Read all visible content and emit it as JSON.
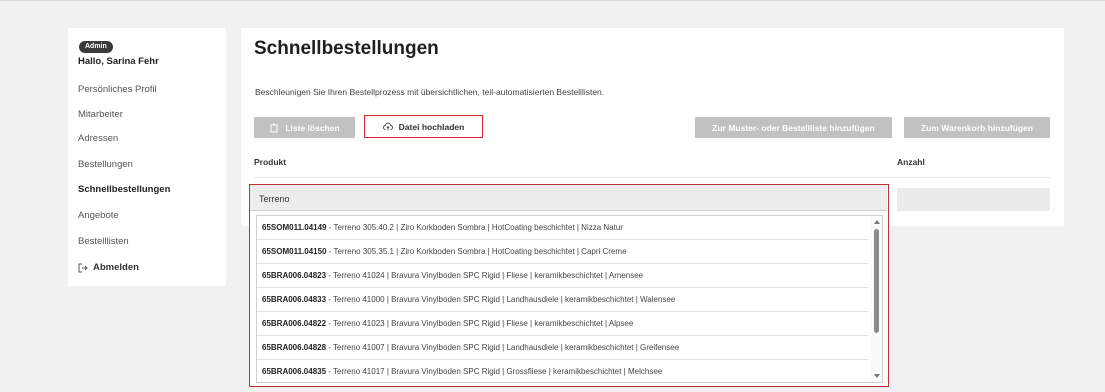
{
  "sidebar": {
    "role_badge": "Admin",
    "greeting": "Hallo, Sarina Fehr",
    "items": [
      {
        "label": "Persönliches Profil"
      },
      {
        "label": "Mitarbeiter"
      },
      {
        "label": "Adressen"
      },
      {
        "label": "Bestellungen"
      },
      {
        "label": "Schnellbestellungen"
      },
      {
        "label": "Angebote"
      },
      {
        "label": "Bestelllisten"
      }
    ],
    "logout_label": "Abmelden"
  },
  "main": {
    "title": "Schnellbestellungen",
    "description": "Beschleunigen Sie Ihren Bestellprozess mit übersichtlichen, teil-automatisierten Bestelllisten.",
    "buttons": {
      "delete_list": "Liste löschen",
      "upload_file": "Datei hochladen",
      "add_to_list": "Zur Muster- oder Bestellliste hinzufügen",
      "add_to_cart": "Zum Warenkorb hinzufügen"
    },
    "table": {
      "col_product": "Produkt",
      "col_quantity": "Anzahl"
    }
  },
  "dropdown": {
    "query": "Terreno",
    "items": [
      {
        "sku": "65SOM011.04149",
        "text": " - Terreno 305.40.2 | Ziro Korkboden Sombra | HotCoating beschichtet | Nizza Natur"
      },
      {
        "sku": "65SOM011.04150",
        "text": " - Terreno 305.35.1 | Ziro Korkboden Sombra | HotCoating beschichtet | Capri Creme"
      },
      {
        "sku": "65BRA006.04823",
        "text": " - Terreno 41024 | Bravura Vinylboden SPC Rigid | Fliese | keramikbeschichtet | Arnensee"
      },
      {
        "sku": "65BRA006.04833",
        "text": " - Terreno 41000 | Bravura Vinylboden SPC Rigid | Landhausdiele | keramikbeschichtet | Walensee"
      },
      {
        "sku": "65BRA006.04822",
        "text": " - Terreno 41023 | Bravura Vinylboden SPC Rigid | Fliese | keramikbeschichtet | Alpsee"
      },
      {
        "sku": "65BRA006.04828",
        "text": " - Terreno 41007 | Bravura Vinylboden SPC Rigid | Landhausdiele | keramikbeschichtet | Greifensee"
      },
      {
        "sku": "65BRA006.04835",
        "text": " - Terreno 41017 | Bravura Vinylboden SPC Rigid | Grossfliese | keramikbeschichtet | Melchsee"
      }
    ]
  },
  "colors": {
    "accent_red": "#d7262e",
    "disabled_grey": "#c1c1c1",
    "badge_dark": "#3a3a3a"
  },
  "icons": {
    "delete": "trash-icon",
    "upload": "upload-cloud-icon",
    "logout": "logout-icon"
  }
}
